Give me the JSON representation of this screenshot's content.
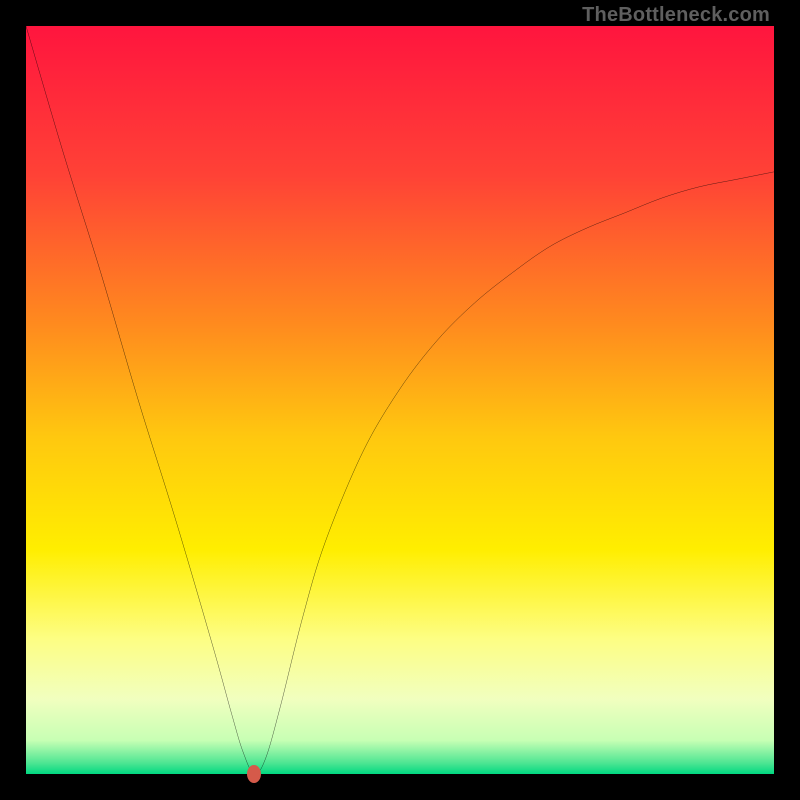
{
  "watermark": "TheBottleneck.com",
  "chart_data": {
    "type": "line",
    "title": "",
    "xlabel": "",
    "ylabel": "",
    "xlim": [
      0,
      100
    ],
    "ylim": [
      0,
      100
    ],
    "gradient_stops": [
      {
        "offset": 0,
        "color": "#ff153e"
      },
      {
        "offset": 0.2,
        "color": "#ff4236"
      },
      {
        "offset": 0.4,
        "color": "#ff8b1e"
      },
      {
        "offset": 0.55,
        "color": "#ffc80f"
      },
      {
        "offset": 0.7,
        "color": "#ffee00"
      },
      {
        "offset": 0.82,
        "color": "#fdfe84"
      },
      {
        "offset": 0.9,
        "color": "#f1ffbf"
      },
      {
        "offset": 0.955,
        "color": "#c7ffb4"
      },
      {
        "offset": 0.985,
        "color": "#4fe693"
      },
      {
        "offset": 1.0,
        "color": "#00d881"
      }
    ],
    "optimum": {
      "x": 30.5,
      "y": 0
    },
    "series": [
      {
        "name": "bottleneck-curve",
        "x": [
          0,
          5,
          10,
          15,
          20,
          25,
          27.5,
          29,
          30.5,
          32,
          34,
          37,
          40,
          45,
          50,
          55,
          60,
          65,
          70,
          75,
          80,
          85,
          90,
          95,
          100
        ],
        "y": [
          100,
          83,
          67,
          50,
          34,
          17,
          8,
          3,
          0,
          2,
          9,
          21,
          31,
          43,
          51.5,
          58,
          63,
          67,
          70.5,
          73,
          75,
          77,
          78.5,
          79.5,
          80.5
        ]
      }
    ]
  }
}
